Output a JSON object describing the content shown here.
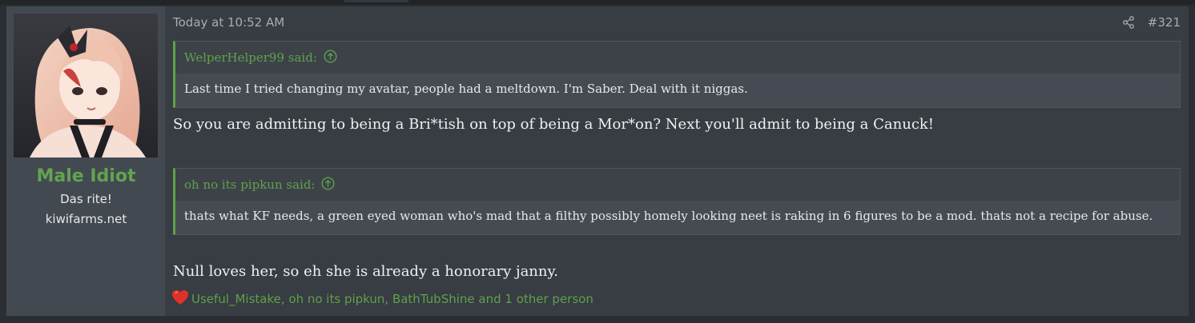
{
  "user": {
    "name": "Male Idiot",
    "title": "Das rite!",
    "site": "kiwifarms.net"
  },
  "post": {
    "date": "Today at 10:52 AM",
    "number": "#321",
    "quotes": [
      {
        "author_line": "WelperHelper99 said:",
        "text": "Last time I tried changing my avatar, people had a meltdown. I'm Saber. Deal with it niggas."
      },
      {
        "author_line": "oh no its pipkun said:",
        "text": "thats what KF needs, a green eyed woman who's mad that a filthy possibly homely looking neet is raking in 6 figures to be a mod. thats not a recipe for abuse."
      }
    ],
    "replies": [
      "So you are admitting to being a Bri*tish on top of being a Mor*on? Next you'll admit to being a Canuck!",
      "Null loves her, so eh she is already a honorary janny."
    ],
    "reactions_text": "Useful_Mistake, oh no its pipkun, BathTubShine and 1 other person"
  },
  "colors": {
    "accent": "#5da24a",
    "username": "#62a44e",
    "heart": "#e0312b"
  },
  "icons": {
    "share": "share-icon",
    "quote_jump": "arrow-up-circle-icon",
    "reaction": "heart-icon"
  }
}
